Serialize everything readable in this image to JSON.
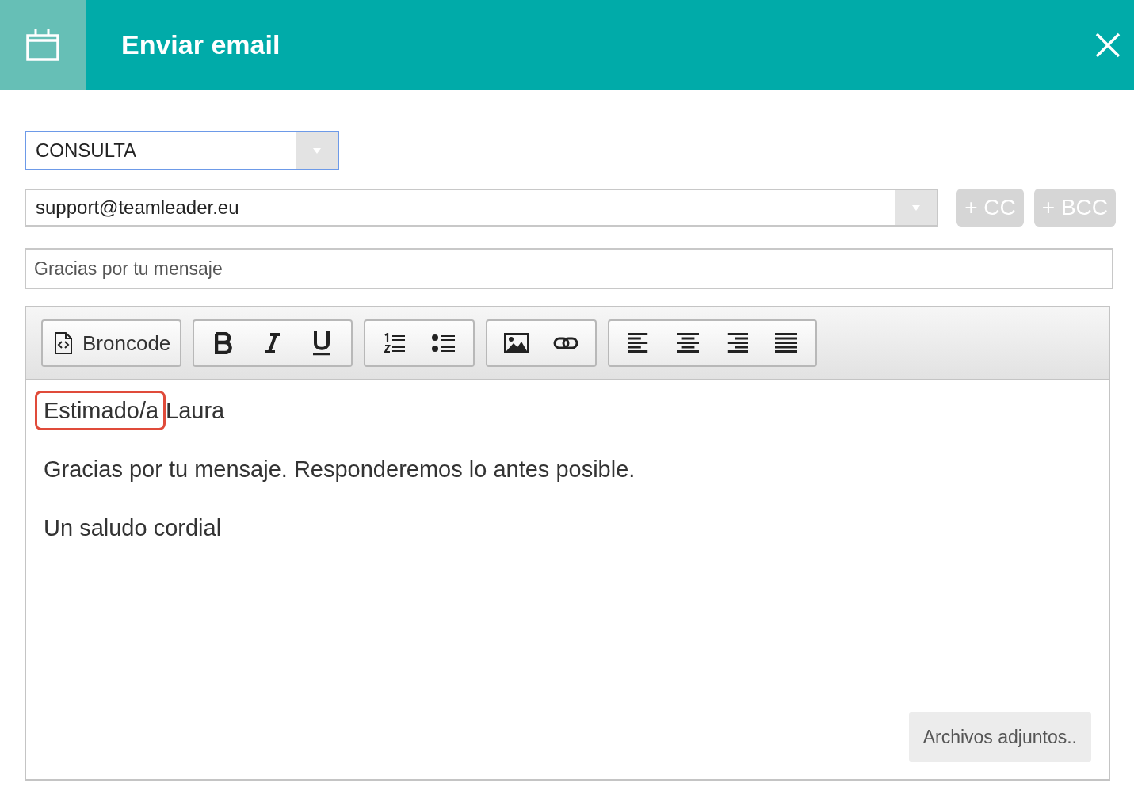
{
  "window": {
    "title": "Enviar email"
  },
  "template_select": {
    "value": "CONSULTA"
  },
  "recipient_select": {
    "value": "support@teamleader.eu"
  },
  "recipient_buttons": [
    "+ CC",
    "+ BCC"
  ],
  "subject": {
    "value": "Gracias por tu mensaje"
  },
  "toolbar": {
    "groups": [
      {
        "tools": [
          {
            "kind": "source",
            "label": "Broncode"
          }
        ]
      },
      {
        "tools": [
          {
            "kind": "bold"
          },
          {
            "kind": "italic"
          },
          {
            "kind": "underline"
          }
        ]
      },
      {
        "tools": [
          {
            "kind": "numbered-list"
          },
          {
            "kind": "bullet-list"
          }
        ]
      },
      {
        "tools": [
          {
            "kind": "image"
          },
          {
            "kind": "link"
          }
        ]
      },
      {
        "tools": [
          {
            "kind": "align-left"
          },
          {
            "kind": "align-center"
          },
          {
            "kind": "align-right"
          },
          {
            "kind": "justify"
          }
        ]
      }
    ]
  },
  "body": {
    "paragraphs": [
      {
        "parts": [
          {
            "text": "Estimado/a",
            "highlighted": true
          },
          {
            "text": "Laura",
            "highlighted": false
          }
        ]
      },
      {
        "parts": [
          {
            "text": "Gracias por tu mensaje. Responderemos lo antes posible.",
            "highlighted": false
          }
        ]
      },
      {
        "parts": [
          {
            "text": "Un saludo cordial",
            "highlighted": false
          }
        ]
      }
    ]
  },
  "attachments_button": "Archivos adjuntos.."
}
